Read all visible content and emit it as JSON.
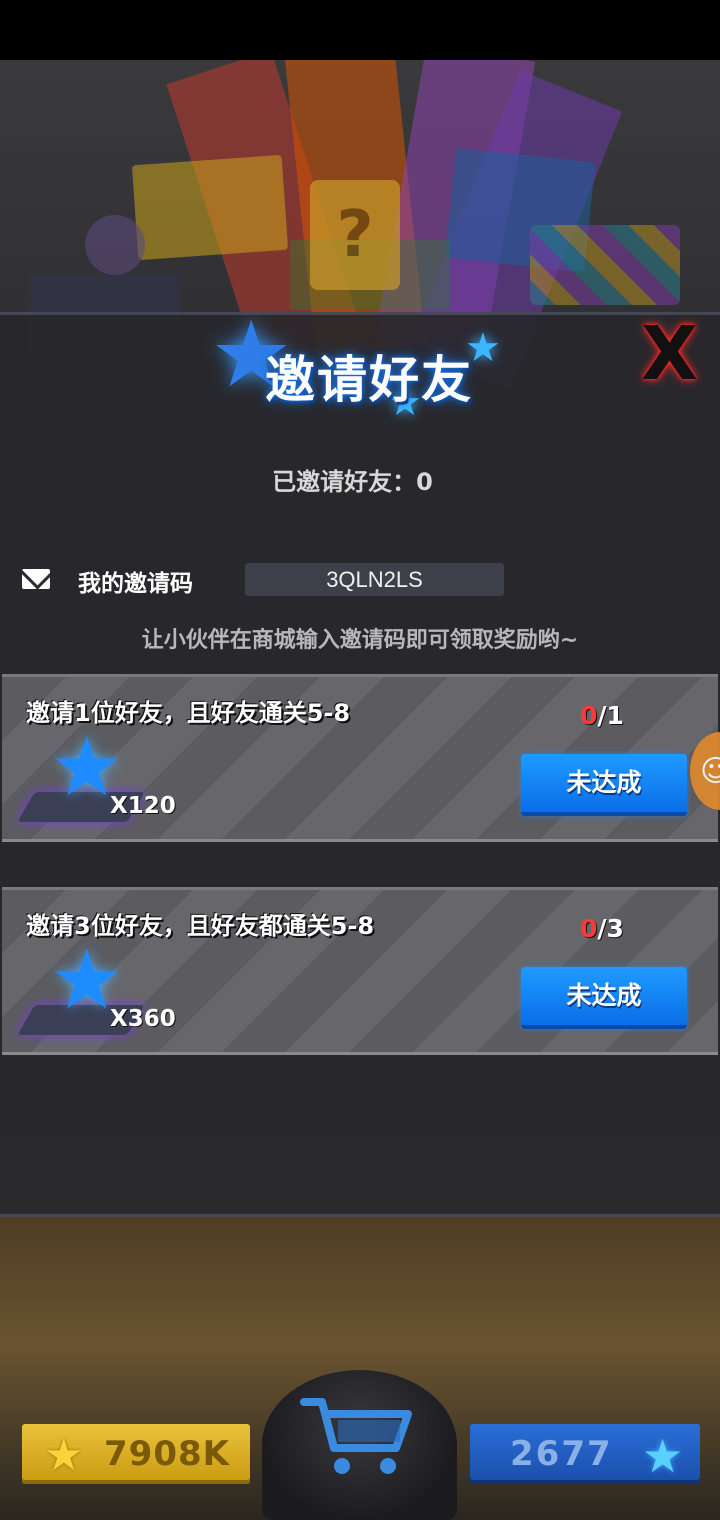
{
  "title": "邀请好友",
  "invited_label": "已邀请好友：0",
  "invite_code": {
    "label": "我的邀请码",
    "value": "3QLN2LS"
  },
  "hint": "让小伙伴在商城输入邀请码即可领取奖励哟~",
  "tasks": [
    {
      "title": "邀请1位好友，且好友通关5-8",
      "progress_current": "0",
      "progress_total": "/1",
      "reward_qty": "X120",
      "button": "未达成"
    },
    {
      "title": "邀请3位好友，且好友都通关5-8",
      "progress_current": "0",
      "progress_total": "/3",
      "reward_qty": "X360",
      "button": "未达成"
    }
  ],
  "footer": {
    "coins": "7908K",
    "gems": "2677"
  },
  "icons": {
    "close": "close-icon",
    "mail": "mail-icon",
    "star": "star-icon",
    "cart": "shopping-cart-icon"
  },
  "colors": {
    "accent_blue": "#1e8bff",
    "progress_red": "#ff3a3a",
    "close_red": "#ff2a2a",
    "coin_gold": "#e9c23a"
  }
}
